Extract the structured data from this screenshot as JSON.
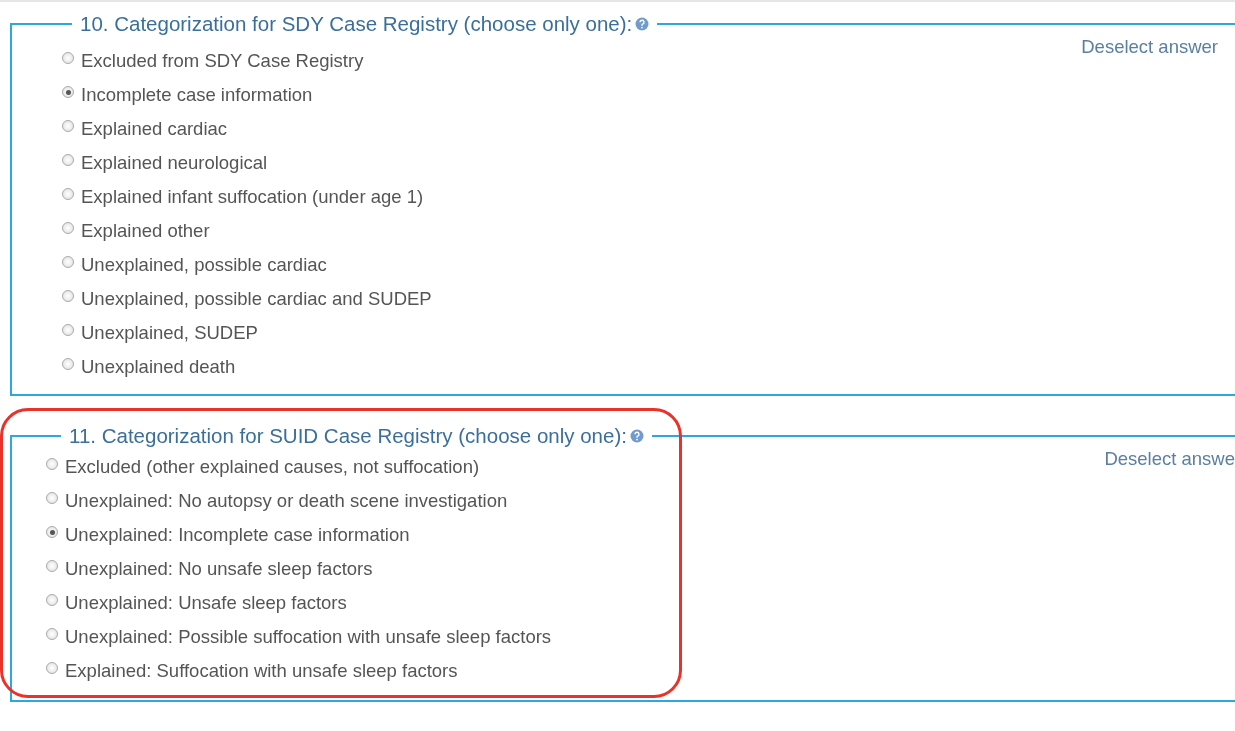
{
  "questions": [
    {
      "title": "10. Categorization for SDY Case Registry (choose only one):",
      "deselect": "Deselect answer",
      "options": [
        {
          "label": "Excluded from SDY Case Registry",
          "selected": false
        },
        {
          "label": "Incomplete case information",
          "selected": true
        },
        {
          "label": "Explained cardiac",
          "selected": false
        },
        {
          "label": "Explained neurological",
          "selected": false
        },
        {
          "label": "Explained infant suffocation (under age 1)",
          "selected": false
        },
        {
          "label": "Explained other",
          "selected": false
        },
        {
          "label": "Unexplained, possible cardiac",
          "selected": false
        },
        {
          "label": "Unexplained, possible cardiac and SUDEP",
          "selected": false
        },
        {
          "label": "Unexplained, SUDEP",
          "selected": false
        },
        {
          "label": "Unexplained death",
          "selected": false
        }
      ]
    },
    {
      "title": "11. Categorization for SUID Case Registry (choose only one):",
      "deselect": "Deselect answe",
      "highlighted": true,
      "options": [
        {
          "label": "Excluded (other explained causes, not suffocation)",
          "selected": false
        },
        {
          "label": "Unexplained: No autopsy or death scene investigation",
          "selected": false
        },
        {
          "label": "Unexplained: Incomplete case information",
          "selected": true
        },
        {
          "label": "Unexplained: No unsafe sleep factors",
          "selected": false
        },
        {
          "label": "Unexplained: Unsafe sleep factors",
          "selected": false
        },
        {
          "label": "Unexplained: Possible suffocation with unsafe sleep factors",
          "selected": false
        },
        {
          "label": "Explained: Suffocation with unsafe sleep factors",
          "selected": false
        }
      ]
    }
  ]
}
